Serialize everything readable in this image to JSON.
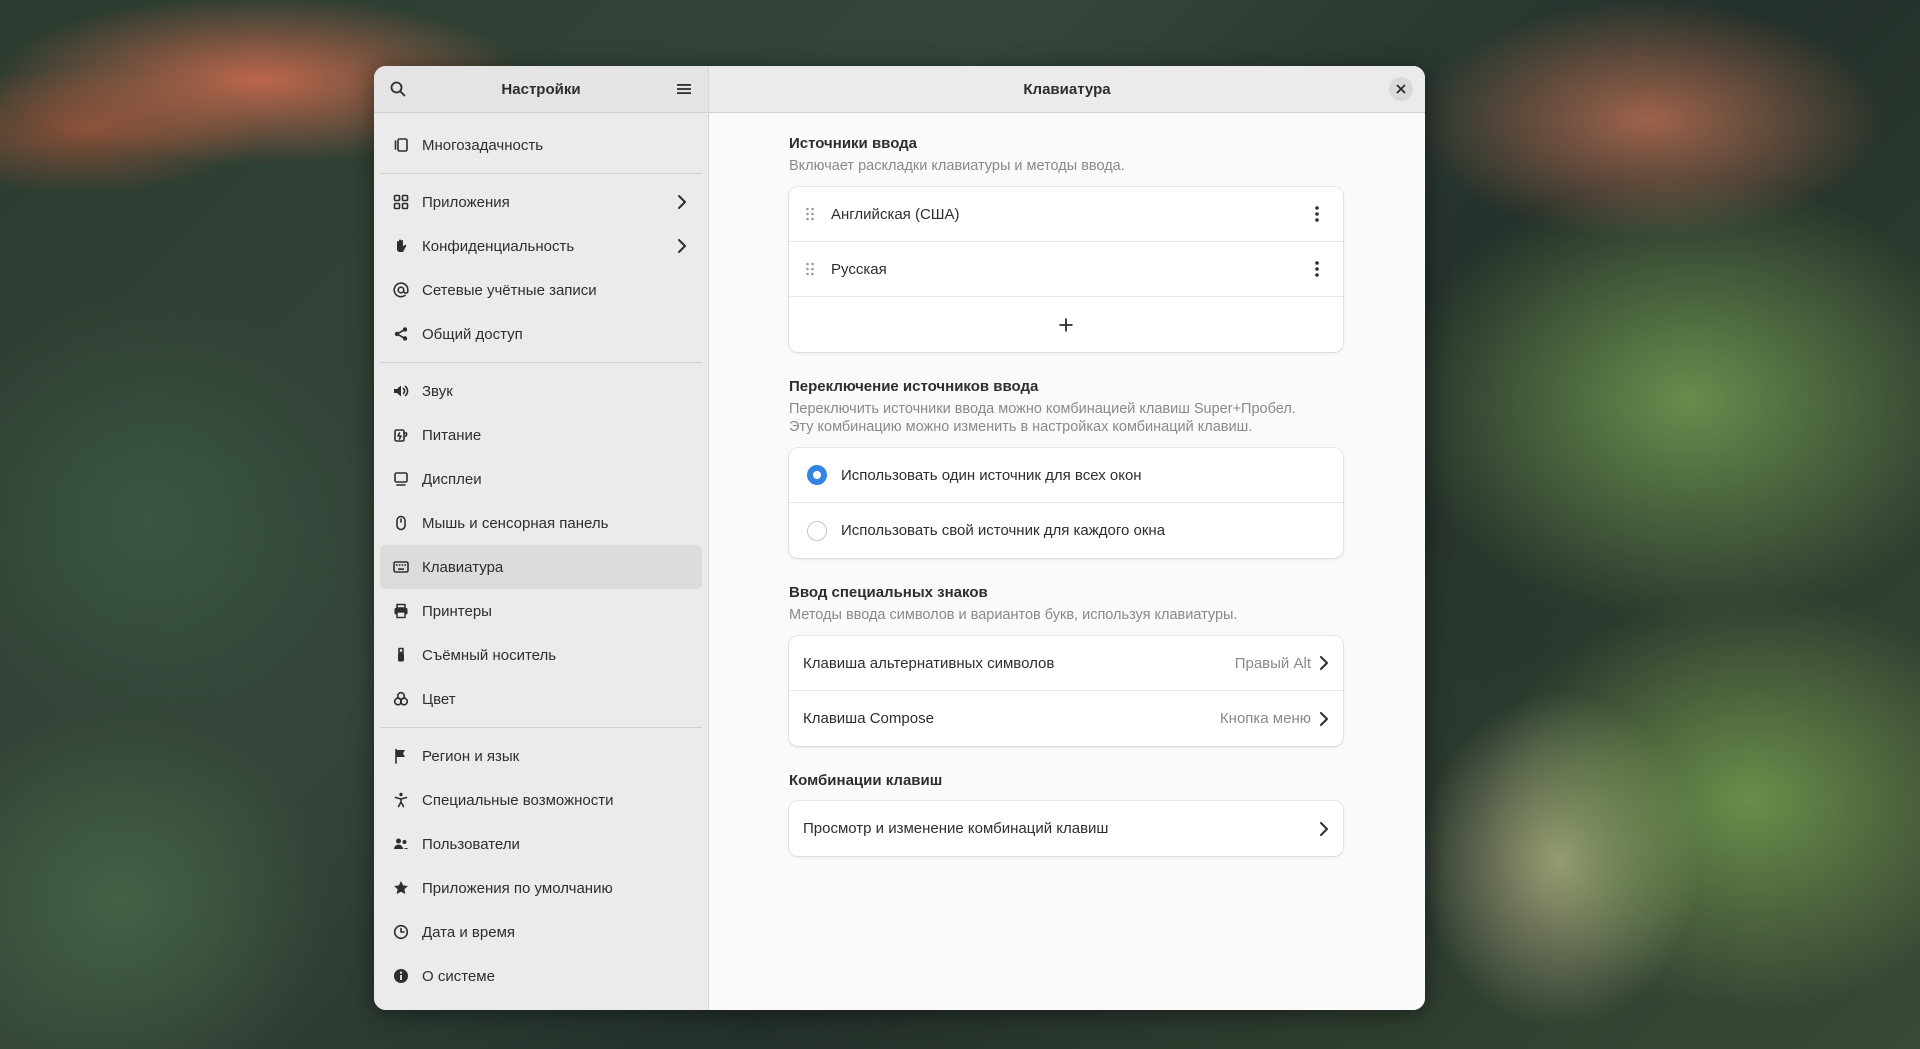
{
  "sidebar": {
    "title": "Настройки",
    "groups": [
      [
        {
          "label": "Многозадачность",
          "icon": "multitasking-icon"
        }
      ],
      [
        {
          "label": "Приложения",
          "icon": "apps-icon",
          "chevron": true
        },
        {
          "label": "Конфиденциальность",
          "icon": "privacy-hand-icon",
          "chevron": true
        },
        {
          "label": "Сетевые учётные записи",
          "icon": "at-icon"
        },
        {
          "label": "Общий доступ",
          "icon": "share-icon"
        }
      ],
      [
        {
          "label": "Звук",
          "icon": "sound-icon"
        },
        {
          "label": "Питание",
          "icon": "power-icon"
        },
        {
          "label": "Дисплеи",
          "icon": "display-icon"
        },
        {
          "label": "Мышь и сенсорная панель",
          "icon": "mouse-icon"
        },
        {
          "label": "Клавиатура",
          "icon": "keyboard-icon",
          "active": true
        },
        {
          "label": "Принтеры",
          "icon": "printer-icon"
        },
        {
          "label": "Съёмный носитель",
          "icon": "usb-icon"
        },
        {
          "label": "Цвет",
          "icon": "color-icon"
        }
      ],
      [
        {
          "label": "Регион и язык",
          "icon": "flag-icon"
        },
        {
          "label": "Специальные возможности",
          "icon": "accessibility-icon"
        },
        {
          "label": "Пользователи",
          "icon": "users-icon"
        },
        {
          "label": "Приложения по умолчанию",
          "icon": "star-icon"
        },
        {
          "label": "Дата и время",
          "icon": "clock-icon"
        },
        {
          "label": "О системе",
          "icon": "info-icon"
        }
      ]
    ]
  },
  "content": {
    "title": "Клавиатура",
    "input_sources": {
      "title": "Источники ввода",
      "desc": "Включает раскладки клавиатуры и методы ввода.",
      "items": [
        "Английская (США)",
        "Русская"
      ],
      "add_label": "+"
    },
    "switching": {
      "title": "Переключение источников ввода",
      "desc_line1": "Переключить источники ввода можно комбинацией клавиш Super+Пробел.",
      "desc_line2": "Эту комбинацию можно изменить в настройках комбинаций клавиш.",
      "options": [
        {
          "label": "Использовать один источник для всех окон",
          "checked": true
        },
        {
          "label": "Использовать свой источник для каждого окна",
          "checked": false
        }
      ]
    },
    "special": {
      "title": "Ввод специальных знаков",
      "desc": "Методы ввода символов и вариантов букв, используя клавиатуры.",
      "rows": [
        {
          "label": "Клавиша альтернативных символов",
          "value": "Правый Alt"
        },
        {
          "label": "Клавиша Compose",
          "value": "Кнопка меню"
        }
      ]
    },
    "shortcuts": {
      "title": "Комбинации клавиш",
      "row_label": "Просмотр и изменение комбинаций клавиш"
    }
  },
  "colors": {
    "accent": "#3584e4"
  }
}
